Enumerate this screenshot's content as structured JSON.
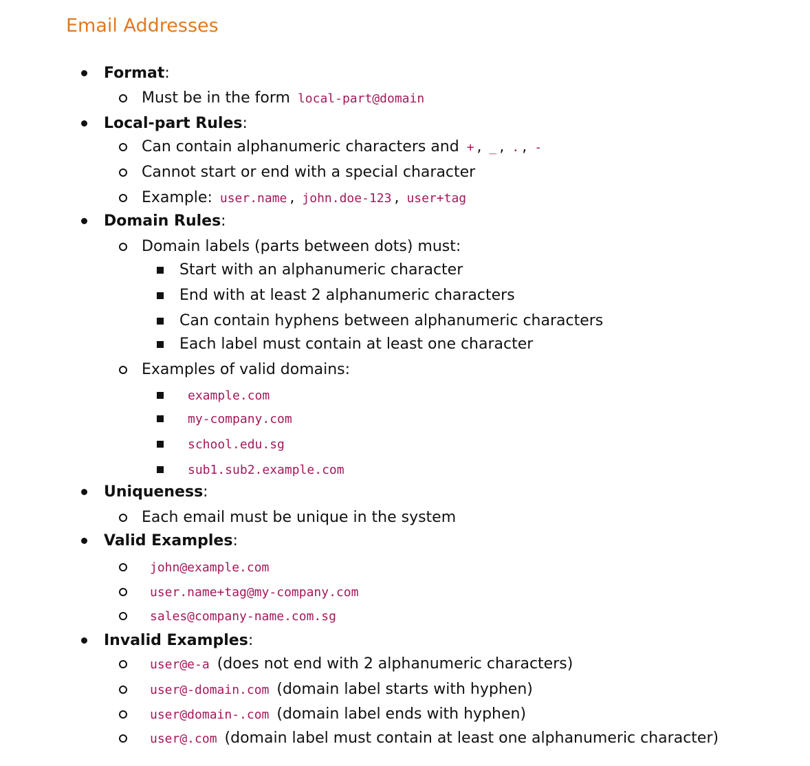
{
  "title": "Email Addresses",
  "format": {
    "label": "Format",
    "colon": ":",
    "rule_text": "Must be in the form ",
    "rule_code": "local-part@domain"
  },
  "local_part": {
    "label": "Local-part Rules",
    "colon": ":",
    "contain_text": "Can contain alphanumeric characters and ",
    "chars": [
      "+",
      "_",
      ".",
      "-"
    ],
    "sep": ", ",
    "start_end_text": "Cannot start or end with a special character",
    "example_label": "Example: ",
    "examples": [
      "user.name",
      "john.doe-123",
      "user+tag"
    ]
  },
  "domain": {
    "label": "Domain Rules",
    "colon": ":",
    "labels_text": "Domain labels (parts between dots) must:",
    "label_rules": [
      "Start with an alphanumeric character",
      "End with at least 2 alphanumeric characters",
      "Can contain hyphens between alphanumeric characters",
      "Each label must contain at least one character"
    ],
    "valid_domains_text": "Examples of valid domains:",
    "valid_domains": [
      "example.com",
      "my-company.com",
      "school.edu.sg",
      "sub1.sub2.example.com"
    ]
  },
  "uniqueness": {
    "label": "Uniqueness",
    "colon": ":",
    "rule": "Each email must be unique in the system"
  },
  "valid": {
    "label": "Valid Examples",
    "colon": ":",
    "examples": [
      "john@example.com",
      "user.name+tag@my-company.com",
      "sales@company-name.com.sg"
    ]
  },
  "invalid": {
    "label": "Invalid Examples",
    "colon": ":",
    "examples": [
      {
        "code": "user@e-a",
        "reason": " (does not end with 2 alphanumeric characters)"
      },
      {
        "code": "user@-domain.com",
        "reason": " (domain label starts with hyphen)"
      },
      {
        "code": "user@domain-.com",
        "reason": " (domain label ends with hyphen)"
      },
      {
        "code": "user@.com",
        "reason": " (domain label must contain at least one alphanumeric character)"
      }
    ]
  }
}
